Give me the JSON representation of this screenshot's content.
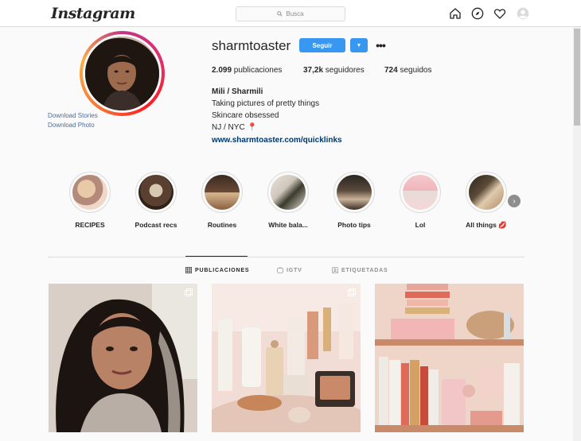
{
  "header": {
    "logo": "Instagram",
    "search_placeholder": "Busca"
  },
  "profile": {
    "username": "sharmtoaster",
    "follow_label": "Seguir",
    "download_stories": "Download Stories",
    "download_photo": "Download Photo",
    "stats": {
      "posts_value": "2.099",
      "posts_label": " publicaciones",
      "followers_value": "37,2k",
      "followers_label": " seguidores",
      "following_value": "724",
      "following_label": " seguidos"
    },
    "bio": {
      "name": "Mili / Sharmili",
      "line1": "Taking pictures of pretty things",
      "line2": "Skincare obsessed",
      "line3": "NJ / NYC 📍",
      "link": "www.sharmtoaster.com/quicklinks"
    }
  },
  "highlights": [
    {
      "label": "RECIPES"
    },
    {
      "label": "Podcast recs"
    },
    {
      "label": "Routines"
    },
    {
      "label": "White bala..."
    },
    {
      "label": "Photo tips"
    },
    {
      "label": "Lol"
    },
    {
      "label": "All things 💋"
    }
  ],
  "tabs": [
    {
      "label": "PUBLICACIONES",
      "icon": "grid-icon"
    },
    {
      "label": "IGTV",
      "icon": "igtv-icon"
    },
    {
      "label": "ETIQUETADAS",
      "icon": "tagged-icon"
    }
  ],
  "colors": {
    "accent": "#3897f0",
    "link": "#4a6d9c",
    "text": "#262626"
  }
}
